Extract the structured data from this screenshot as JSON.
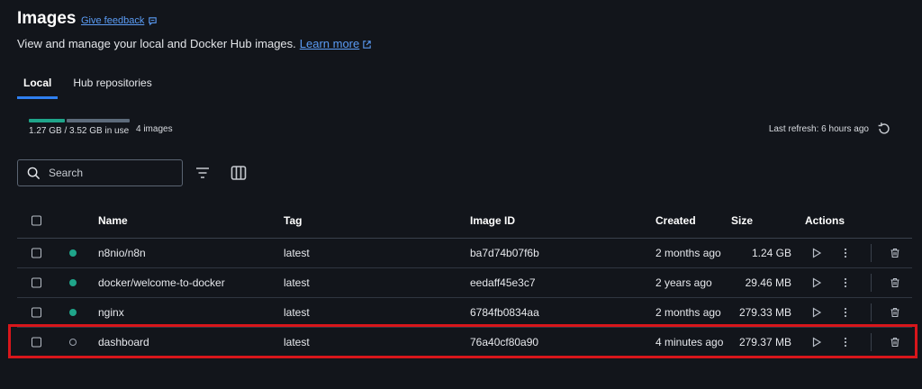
{
  "header": {
    "title": "Images",
    "feedback_label": "Give feedback",
    "subtitle": "View and manage your local and Docker Hub images.",
    "learn_more": "Learn more"
  },
  "tabs": [
    {
      "label": "Local",
      "active": true
    },
    {
      "label": "Hub repositories",
      "active": false
    }
  ],
  "usage": {
    "text": "1.27 GB / 3.52 GB in use",
    "used_fraction": 0.36,
    "image_count": "4 images"
  },
  "refresh": {
    "label": "Last refresh: 6 hours ago"
  },
  "search": {
    "placeholder": "Search"
  },
  "table": {
    "headers": {
      "name": "Name",
      "tag": "Tag",
      "image_id": "Image ID",
      "created": "Created",
      "size": "Size",
      "actions": "Actions"
    },
    "rows": [
      {
        "name": "n8nio/n8n",
        "tag": "latest",
        "image_id": "ba7d74b07f6b",
        "created": "2 months ago",
        "size": "1.24 GB",
        "status": "in-use"
      },
      {
        "name": "docker/welcome-to-docker",
        "tag": "latest",
        "image_id": "eedaff45e3c7",
        "created": "2 years ago",
        "size": "29.46 MB",
        "status": "in-use"
      },
      {
        "name": "nginx",
        "tag": "latest",
        "image_id": "6784fb0834aa",
        "created": "2 months ago",
        "size": "279.33 MB",
        "status": "in-use"
      },
      {
        "name": "dashboard",
        "tag": "latest",
        "image_id": "76a40cf80a90",
        "created": "4 minutes ago",
        "size": "279.37 MB",
        "status": "unused"
      }
    ]
  },
  "colors": {
    "accent": "#2f7ff0",
    "in_use": "#1fa58a",
    "highlight": "#d8161b",
    "background": "#12151b"
  }
}
